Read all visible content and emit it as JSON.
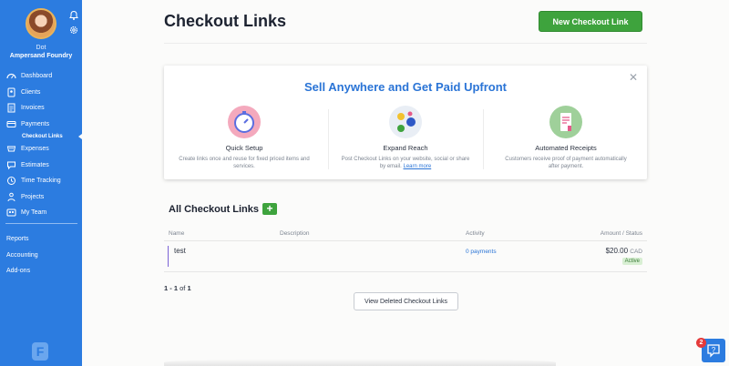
{
  "user": {
    "name": "Dot",
    "org": "Ampersand Foundry"
  },
  "sidebar": {
    "items": [
      {
        "label": "Dashboard",
        "icon": "dashboard-icon"
      },
      {
        "label": "Clients",
        "icon": "clients-icon"
      },
      {
        "label": "Invoices",
        "icon": "invoices-icon"
      },
      {
        "label": "Payments",
        "icon": "payments-icon"
      },
      {
        "label": "Expenses",
        "icon": "expenses-icon"
      },
      {
        "label": "Estimates",
        "icon": "estimates-icon"
      },
      {
        "label": "Time Tracking",
        "icon": "clock-icon"
      },
      {
        "label": "Projects",
        "icon": "projects-icon"
      },
      {
        "label": "My Team",
        "icon": "team-icon"
      }
    ],
    "subitem": "Checkout Links",
    "bottom": [
      "Reports",
      "Accounting",
      "Add-ons"
    ],
    "logo_letter": "F"
  },
  "page": {
    "title": "Checkout Links",
    "new_button": "New Checkout Link"
  },
  "promo": {
    "title": "Sell Anywhere and Get Paid Upfront",
    "close": "✕",
    "features": [
      {
        "title": "Quick Setup",
        "desc": "Create links once and reuse for fixed priced items and services."
      },
      {
        "title": "Expand Reach",
        "desc": "Post Checkout Links on your website, social or share by email.",
        "link": "Learn more"
      },
      {
        "title": "Automated Receipts",
        "desc": "Customers receive proof of payment automatically after payment."
      }
    ]
  },
  "list": {
    "title": "All Checkout Links",
    "add": "+",
    "columns": {
      "name": "Name",
      "description": "Description",
      "activity": "Activity",
      "amount": "Amount / Status"
    },
    "rows": [
      {
        "name": "test",
        "description": "",
        "activity": "0 payments",
        "amount": "$20.00",
        "currency": "CAD",
        "status": "Active"
      }
    ]
  },
  "pager": {
    "range": "1 - 1",
    "of": "of",
    "total": "1"
  },
  "deleted_button": "View Deleted Checkout Links",
  "help": {
    "badge": "2"
  },
  "colors": {
    "sidebar": "#2c7ce0",
    "accent_green": "#3ea33d",
    "link_blue": "#2a74d6"
  }
}
